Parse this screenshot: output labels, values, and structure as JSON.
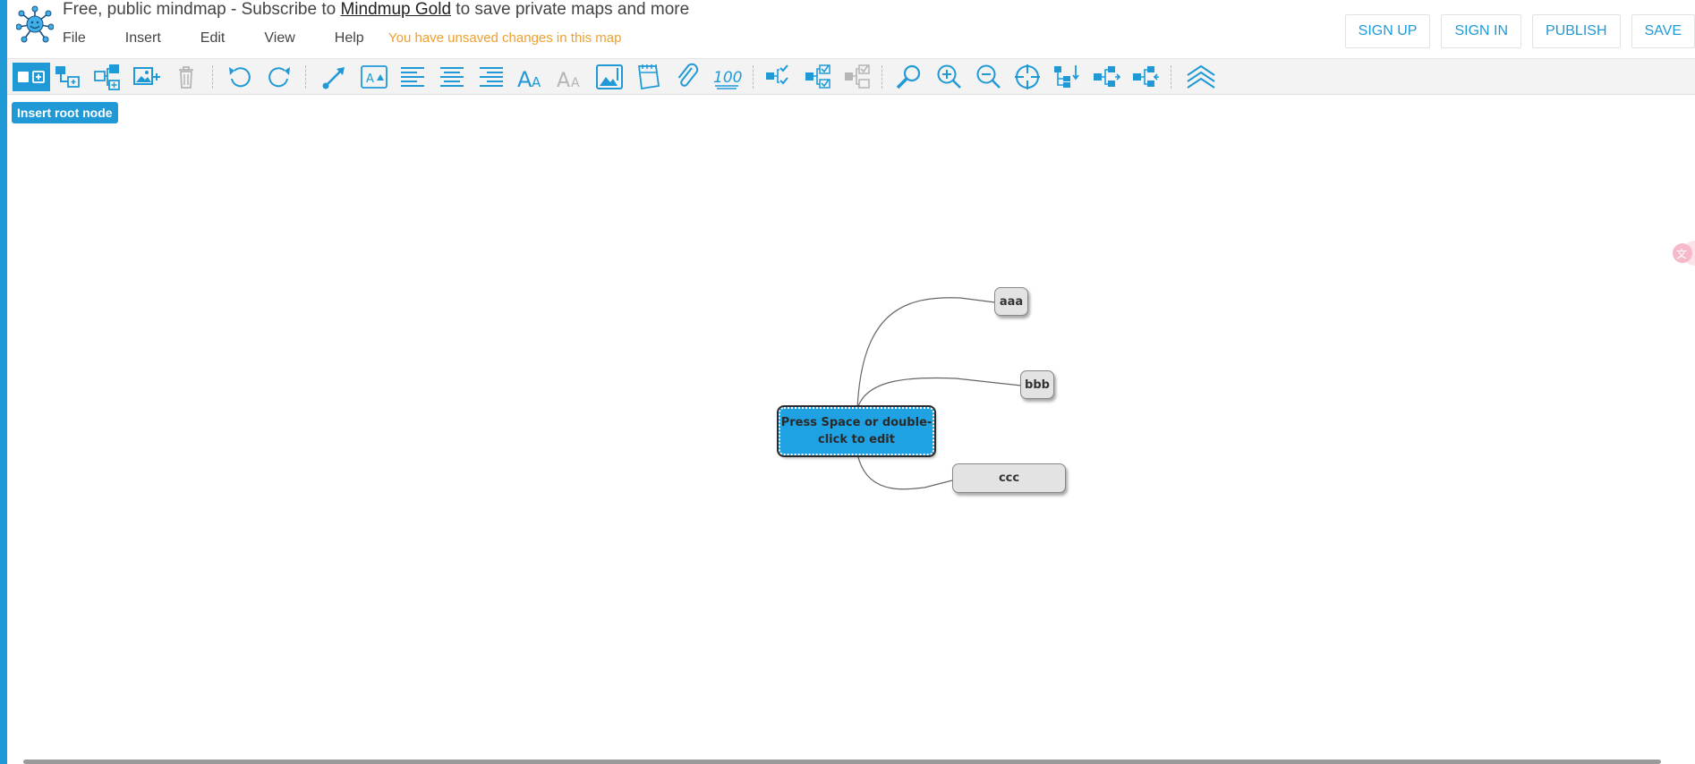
{
  "header": {
    "title_prefix": "Free, public mindmap - Subscribe to ",
    "title_link": "Mindmup Gold",
    "title_suffix": " to save private maps and more",
    "unsaved_notice": "You have unsaved changes in this map"
  },
  "menu": {
    "file": "File",
    "insert": "Insert",
    "edit": "Edit",
    "view": "View",
    "help": "Help"
  },
  "top_buttons": {
    "sign_up": "SIGN UP",
    "sign_in": "SIGN IN",
    "publish": "PUBLISH",
    "save": "SAVE"
  },
  "toolbar": {
    "insert_root_label": "Insert root node",
    "accent_color": "#1f9ad6",
    "icons": [
      "add-sibling-icon",
      "add-child-icon",
      "add-parent-icon",
      "add-image-icon",
      "delete-icon",
      "undo-icon",
      "redo-icon",
      "connector-icon",
      "text-style-icon",
      "align-left-icon",
      "align-center-icon",
      "align-right-icon",
      "increase-font-icon",
      "decrease-font-icon",
      "background-image-icon",
      "date-icon",
      "link-icon",
      "progress-icon",
      "check-icon",
      "check-children-icon",
      "check-disabled-icon",
      "search-icon",
      "zoom-in-icon",
      "zoom-out-icon",
      "center-icon",
      "layout-top-down-icon",
      "layout-left-right-icon",
      "layout-right-left-icon",
      "collapse-icon"
    ]
  },
  "mindmap": {
    "root": "Press Space or double-click to edit",
    "root_line1": "Press Space or double-",
    "root_line2": "click to edit",
    "children": [
      "aaa",
      "bbb",
      "ccc"
    ]
  }
}
